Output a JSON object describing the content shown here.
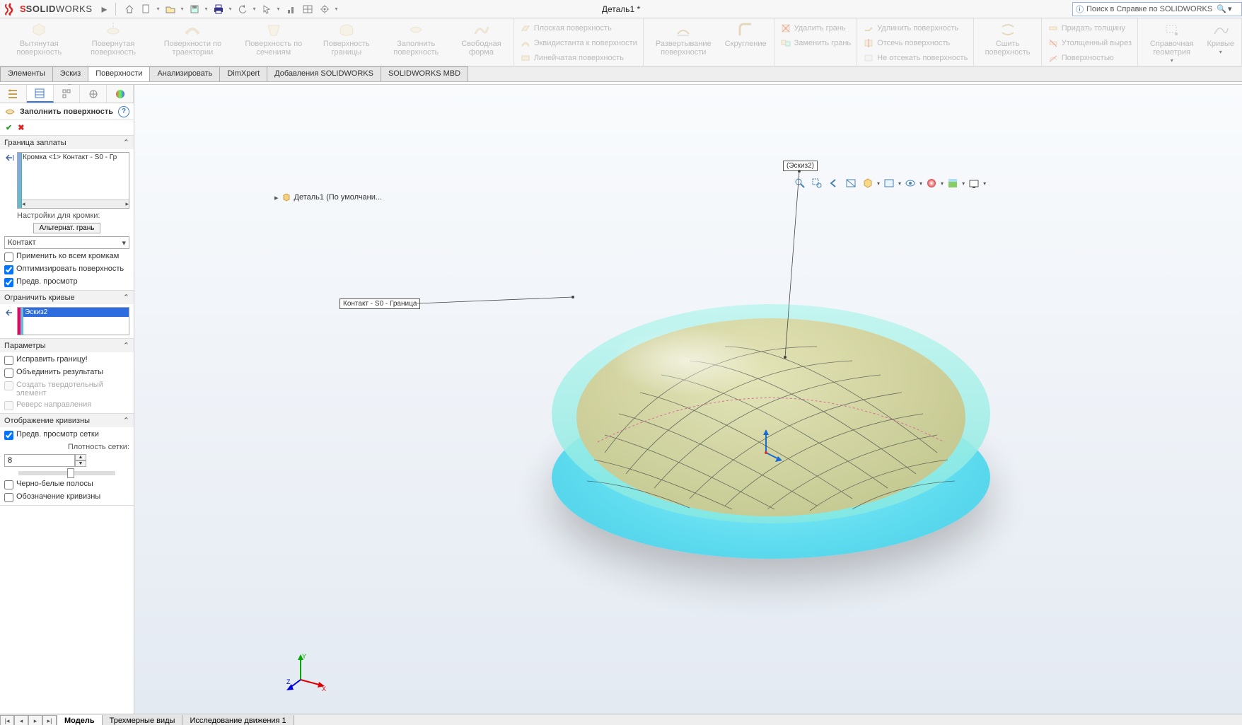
{
  "app": {
    "logo_prefix": "S",
    "logo_text": "SOLID",
    "logo_text2": "WORKS"
  },
  "document_title": "Деталь1 *",
  "search": {
    "placeholder": "Поиск в Справке по SOLIDWORKS"
  },
  "ribbon": {
    "big": {
      "extrude": "Вытянутая поверхность",
      "revolve": "Повернутая поверхность",
      "sweep": "Поверхности по траектории",
      "loft": "Поверхность по сечениям",
      "boundary": "Поверхность границы",
      "fill": "Заполнить поверхность",
      "freeform": "Свободная форма",
      "untrim": "Развертывание поверхности",
      "fillet": "Скругление",
      "knit": "Сшить поверхность",
      "refgeom": "Справочная геометрия",
      "curves": "Кривые"
    },
    "small": {
      "planar": "Плоская поверхность",
      "offset": "Эквидистанта к поверхности",
      "ruled": "Линейчатая поверхность",
      "delete": "Удалить грань",
      "replace": "Заменить грань",
      "extend": "Удлинить поверхность",
      "trim": "Отсечь поверхность",
      "notrim": "Не отсекать поверхность",
      "thicken": "Придать толщину",
      "thickcut": "Утолщенный вырез",
      "cutwsurf": "Поверхностью"
    }
  },
  "command_tabs": [
    "Элементы",
    "Эскиз",
    "Поверхности",
    "Анализировать",
    "DimXpert",
    "Добавления SOLIDWORKS",
    "SOLIDWORKS MBD"
  ],
  "active_tab": "Поверхности",
  "feature_tree_fly": "Деталь1  (По умолчани...",
  "pm": {
    "title": "Заполнить поверхность",
    "sec_boundary": "Граница заплаты",
    "boundary_item": "Кромка <1> Контакт - S0 - Гр",
    "edge_settings_lbl": "Настройки для кромки:",
    "alt_face_btn": "Альтернат. грань",
    "contact_combo": "Контакт",
    "apply_all": "Применить ко всем кромкам",
    "optimize": "Оптимизировать поверхность",
    "preview": "Предв. просмотр",
    "sec_constraints": "Ограничить кривые",
    "constraint_item": "Эскиз2",
    "sec_opts": "Параметры",
    "fix_boundary": "Исправить границу!",
    "merge": "Объединить результаты",
    "create_solid": "Создать твердотельный элемент",
    "reverse": "Реверс направления",
    "sec_curv": "Отображение кривизны",
    "mesh_preview": "Предв. просмотр сетки",
    "mesh_density_lbl": "Плотность сетки:",
    "mesh_density_val": "8",
    "zebra": "Черно-белые полосы",
    "curv_label": "Обозначение кривизны"
  },
  "callouts": {
    "sketch": "(Эскиз2)",
    "edge": "Контакт - S0 - Граница"
  },
  "bottom_tabs": [
    "Модель",
    "Трехмерные виды",
    "Исследование движения 1"
  ],
  "active_bottom_tab": "Модель"
}
